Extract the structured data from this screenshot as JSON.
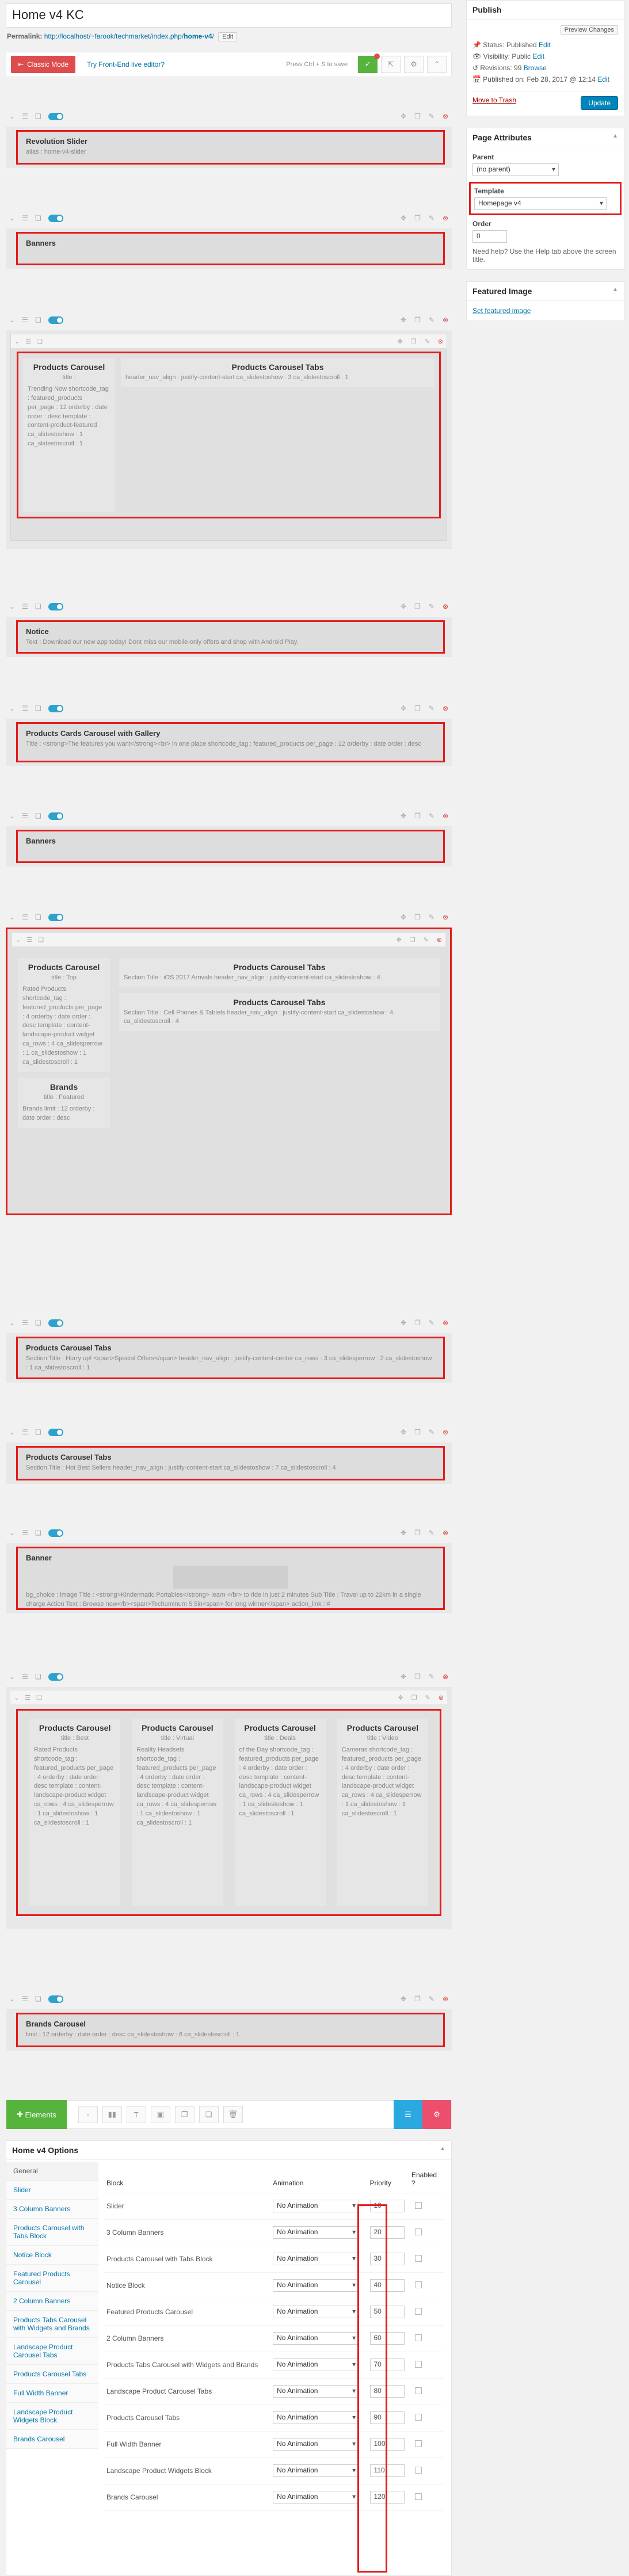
{
  "page": {
    "title": "Home v4 KC",
    "permalink_label": "Permalink:",
    "permalink_base": "http://localhost/~farook/techmarket/index.php/",
    "permalink_slug": "home-v4",
    "edit_label": "Edit"
  },
  "toolbar": {
    "classic_mode": "Classic Mode",
    "front_end": "Try Front-End live editor?",
    "save_hint": "Press Ctrl + S to save"
  },
  "rows": [
    {
      "title": "Revolution Slider",
      "meta": "alias : home-v4-slider"
    },
    {
      "title": "Banners",
      "meta": ""
    },
    {
      "title": "Products Carousel",
      "subtitle": "title :",
      "body": "Trending Now shortcode_tag : featured_products per_page : 12 orderby : date order : desc template : content-product-featured ca_slidestoshow : 1 ca_slidestoscroll : 1",
      "tabs_title": "Products Carousel Tabs",
      "tabs_meta": "header_nav_align : justify-content-start ca_slidestoshow : 3 ca_slidestoscroll : 1"
    },
    {
      "title": "Notice",
      "meta": "Text : Download our new app today! Dont miss our mobile-only offers and shop with Android Play."
    },
    {
      "title": "Products Cards Carousel with Gallery",
      "meta": "Title : <strong>The features you want</strong><br> in one place shortcode_tag : featured_products per_page : 12 orderby : date order : desc"
    },
    {
      "title": "Banners",
      "meta": ""
    }
  ],
  "block7": {
    "carousel": {
      "title": "Products Carousel",
      "subtitle": "title : Top",
      "body": "Rated Products shortcode_tag : featured_products per_page : 4 orderby : date order : desc template : content-landscape-product widget ca_rows : 4 ca_slidesperrow : 1 ca_slidestoshow : 1 ca_slidestoscroll : 1"
    },
    "brands": {
      "title": "Brands",
      "subtitle": "title : Featured",
      "body": "Brands limit : 12 orderby : date order : desc"
    },
    "tabs1": {
      "title": "Products Carousel Tabs",
      "meta": "Section Title : iOS 2017 Arrivals header_nav_align : justify-content-start ca_slidestoshow : 4"
    },
    "tabs2": {
      "title": "Products Carousel Tabs",
      "meta": "Section Title : Cell Phones & Tablets header_nav_align : justify-content-start ca_slidestoshow : 4 ca_slidestoscroll : 4"
    }
  },
  "rows2": [
    {
      "title": "Products Carousel Tabs",
      "meta": "Section Title : Hurry up! <span>Special Offers</span> header_nav_align : justify-content-center ca_rows : 3 ca_slidesperrow : 2 ca_slidestoshow : 1 ca_slidestoscroll : 1"
    },
    {
      "title": "Products Carousel Tabs",
      "meta": "Section Title : Hot Best Sellers header_nav_align : justify-content-start ca_slidestoshow : 7 ca_slidestoscroll : 4"
    },
    {
      "title": "Banner",
      "meta": "bg_choice : image Title : <strong>Kindermatic Portables</strong> learn </br> to ride in just 2 minutes Sub Title : Travel up to 22km in a single charge Action Text : Browse now</b><span>Techuminum 5.5in<span> for long winner</span> action_link : #"
    }
  ],
  "block11": [
    {
      "title": "Products Carousel",
      "subtitle": "title : Best",
      "body": "Rated Products shortcode_tag : featured_products per_page : 4 orderby : date order : desc template : content-landscape-product widget ca_rows : 4 ca_slidesperrow : 1 ca_slidestoshow : 1 ca_slidestoscroll : 1"
    },
    {
      "title": "Products Carousel",
      "subtitle": "title : Virtual",
      "body": "Reality Headsets shortcode_tag : featured_products per_page : 4 orderby : date order : desc template : content-landscape-product widget ca_rows : 4 ca_slidesperrow : 1 ca_slidestoshow : 1 ca_slidestoscroll : 1"
    },
    {
      "title": "Products Carousel",
      "subtitle": "title : Deals",
      "body": "of the Day shortcode_tag : featured_products per_page : 4 orderby : date order : desc template : content-landscape-product widget ca_rows : 4 ca_slidesperrow : 1 ca_slidestoshow : 1 ca_slidestoscroll : 1"
    },
    {
      "title": "Products Carousel",
      "subtitle": "title : Video",
      "body": "Cameras shortcode_tag : featured_products per_page : 4 orderby : date order : desc template : content-landscape-product widget ca_rows : 4 ca_slidesperrow : 1 ca_slidestoshow : 1 ca_slidestoscroll : 1"
    }
  ],
  "brands_row": {
    "title": "Brands Carousel",
    "meta": "limit : 12 orderby : date order : desc ca_slidestoshow : 6 ca_slidestoscroll : 1"
  },
  "bottom": {
    "elements": "Elements"
  },
  "options": {
    "title": "Home v4 Options",
    "tabs": [
      "General",
      "Slider",
      "3 Column Banners",
      "Products Carousel with Tabs Block",
      "Notice Block",
      "Featured Products Carousel",
      "2 Column Banners",
      "Products Tabs Carousel with Widgets and Brands",
      "Landscape Product Carousel Tabs",
      "Products Carousel Tabs",
      "Full Width Banner",
      "Landscape Product Widgets Block",
      "Brands Carousel"
    ],
    "headers": {
      "block": "Block",
      "animation": "Animation",
      "priority": "Priority",
      "enabled": "Enabled ?"
    },
    "rows": [
      {
        "block": "Slider",
        "animation": "No Animation",
        "priority": "10"
      },
      {
        "block": "3 Column Banners",
        "animation": "No Animation",
        "priority": "20"
      },
      {
        "block": "Products Carousel with Tabs Block",
        "animation": "No Animation",
        "priority": "30"
      },
      {
        "block": "Notice Block",
        "animation": "No Animation",
        "priority": "40"
      },
      {
        "block": "Featured Products Carousel",
        "animation": "No Animation",
        "priority": "50"
      },
      {
        "block": "2 Column Banners",
        "animation": "No Animation",
        "priority": "60"
      },
      {
        "block": "Products Tabs Carousel with Widgets and Brands",
        "animation": "No Animation",
        "priority": "70"
      },
      {
        "block": "Landscape Product Carousel Tabs",
        "animation": "No Animation",
        "priority": "80"
      },
      {
        "block": "Products Carousel Tabs",
        "animation": "No Animation",
        "priority": "90"
      },
      {
        "block": "Full Width Banner",
        "animation": "No Animation",
        "priority": "100"
      },
      {
        "block": "Landscape Product Widgets Block",
        "animation": "No Animation",
        "priority": "110"
      },
      {
        "block": "Brands Carousel",
        "animation": "No Animation",
        "priority": "120"
      }
    ]
  },
  "sidebar": {
    "publish": {
      "title": "Publish",
      "preview": "Preview Changes",
      "status": "Status: Published",
      "visibility": "Visibility: Public",
      "revisions": "Revisions: 99",
      "browse": "Browse",
      "published_on": "Published on: Feb 28, 2017 @ 12:14",
      "edit": "Edit",
      "trash": "Move to Trash",
      "update": "Update"
    },
    "attributes": {
      "title": "Page Attributes",
      "parent_label": "Parent",
      "parent_value": "(no parent)",
      "template_label": "Template",
      "template_value": "Homepage v4",
      "order_label": "Order",
      "order_value": "0",
      "help": "Need help? Use the Help tab above the screen title."
    },
    "featured": {
      "title": "Featured Image",
      "link": "Set featured image"
    }
  }
}
